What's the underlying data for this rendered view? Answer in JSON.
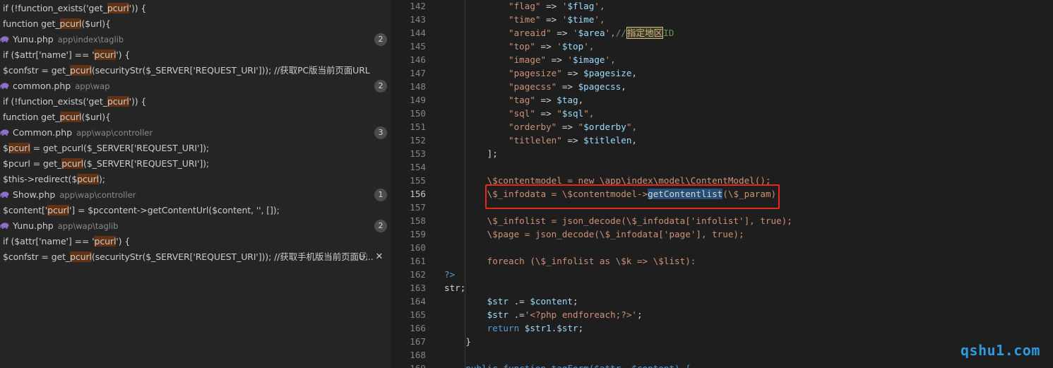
{
  "search_results": [
    {
      "kind": "match",
      "parts": [
        "if (!function_exists('get_",
        {
          "hl": "pcurl"
        },
        "')) {"
      ]
    },
    {
      "kind": "match",
      "parts": [
        "function get_",
        {
          "hl": "pcurl"
        },
        "($url){"
      ]
    },
    {
      "kind": "file",
      "name": "Yunu.php",
      "path": "app\\index\\taglib",
      "count": "2",
      "icon": "php-elephant-icon"
    },
    {
      "kind": "match",
      "parts": [
        "if ($attr['name'] == '",
        {
          "hl": "pcurl"
        },
        "') {"
      ]
    },
    {
      "kind": "match",
      "parts": [
        "$confstr = get_",
        {
          "hl": "pcurl"
        },
        "(securityStr($_SERVER['REQUEST_URI'])); //获取PC版当前页面URL"
      ]
    },
    {
      "kind": "file",
      "name": "common.php",
      "path": "app\\wap",
      "count": "2",
      "icon": "php-elephant-icon"
    },
    {
      "kind": "match",
      "parts": [
        "if (!function_exists('get_",
        {
          "hl": "pcurl"
        },
        "')) {"
      ]
    },
    {
      "kind": "match",
      "parts": [
        "function get_",
        {
          "hl": "pcurl"
        },
        "($url){"
      ]
    },
    {
      "kind": "file",
      "name": "Common.php",
      "path": "app\\wap\\controller",
      "count": "3",
      "icon": "php-elephant-icon"
    },
    {
      "kind": "match",
      "parts": [
        "$",
        {
          "hl": "pcurl"
        },
        " = get_pcurl($_SERVER['REQUEST_URI']);"
      ]
    },
    {
      "kind": "match",
      "parts": [
        "$pcurl = get_",
        {
          "hl": "pcurl"
        },
        "($_SERVER['REQUEST_URI']);"
      ]
    },
    {
      "kind": "match",
      "parts": [
        "$this->redirect($",
        {
          "hl": "pcurl"
        },
        ");"
      ]
    },
    {
      "kind": "file",
      "name": "Show.php",
      "path": "app\\wap\\controller",
      "count": "1",
      "icon": "php-elephant-icon"
    },
    {
      "kind": "match",
      "parts": [
        "$content['",
        {
          "hl": "pcurl"
        },
        "'] = $pccontent->getContentUrl($content, '', []);"
      ]
    },
    {
      "kind": "file",
      "name": "Yunu.php",
      "path": "app\\wap\\taglib",
      "count": "2",
      "icon": "php-elephant-icon"
    },
    {
      "kind": "match",
      "parts": [
        "if ($attr['name'] == '",
        {
          "hl": "pcurl"
        },
        "') {"
      ]
    },
    {
      "kind": "match",
      "actions": true,
      "parts": [
        "$confstr = get_",
        {
          "hl": "pcurl"
        },
        "(securityStr($_SERVER['REQUEST_URI'])); //获取手机版当前页面U..."
      ]
    }
  ],
  "row_actions": {
    "replace_icon": "replace-icon",
    "replace_glyph": "⎘",
    "dismiss_icon": "close-icon",
    "dismiss_glyph": "✕"
  },
  "editor": {
    "active_line": "156",
    "lines": [
      {
        "n": "142",
        "t": [
          [
            "            ",
            "op"
          ],
          [
            "\"flag\"",
            "str"
          ],
          [
            " => ",
            "op"
          ],
          [
            "'",
            "str"
          ],
          [
            "$flag",
            "var"
          ],
          [
            "',",
            "str"
          ]
        ]
      },
      {
        "n": "143",
        "t": [
          [
            "            ",
            "op"
          ],
          [
            "\"time\"",
            "str"
          ],
          [
            " => ",
            "op"
          ],
          [
            "'",
            "str"
          ],
          [
            "$time",
            "var"
          ],
          [
            "',",
            "str"
          ]
        ]
      },
      {
        "n": "144",
        "t": [
          [
            "            ",
            "op"
          ],
          [
            "\"areaid\"",
            "str"
          ],
          [
            " => ",
            "op"
          ],
          [
            "'",
            "str"
          ],
          [
            "$area",
            "var"
          ],
          [
            "',",
            "str"
          ],
          [
            "//",
            "cmt"
          ],
          [
            "指定地区",
            "cmtbox"
          ],
          [
            "ID",
            "cmt"
          ]
        ]
      },
      {
        "n": "145",
        "t": [
          [
            "            ",
            "op"
          ],
          [
            "\"top\"",
            "str"
          ],
          [
            " => ",
            "op"
          ],
          [
            "'",
            "str"
          ],
          [
            "$top",
            "var"
          ],
          [
            "',",
            "str"
          ]
        ]
      },
      {
        "n": "146",
        "t": [
          [
            "            ",
            "op"
          ],
          [
            "\"image\"",
            "str"
          ],
          [
            " => ",
            "op"
          ],
          [
            "'",
            "str"
          ],
          [
            "$image",
            "var"
          ],
          [
            "',",
            "str"
          ]
        ]
      },
      {
        "n": "147",
        "t": [
          [
            "            ",
            "op"
          ],
          [
            "\"pagesize\"",
            "str"
          ],
          [
            " => ",
            "op"
          ],
          [
            "$pagesize",
            "var"
          ],
          [
            ",",
            "op"
          ]
        ]
      },
      {
        "n": "148",
        "t": [
          [
            "            ",
            "op"
          ],
          [
            "\"pagecss\"",
            "str"
          ],
          [
            " => ",
            "op"
          ],
          [
            "$pagecss",
            "var"
          ],
          [
            ",",
            "op"
          ]
        ]
      },
      {
        "n": "149",
        "t": [
          [
            "            ",
            "op"
          ],
          [
            "\"tag\"",
            "str"
          ],
          [
            " => ",
            "op"
          ],
          [
            "$tag",
            "var"
          ],
          [
            ",",
            "op"
          ]
        ]
      },
      {
        "n": "150",
        "t": [
          [
            "            ",
            "op"
          ],
          [
            "\"sql\"",
            "str"
          ],
          [
            " => ",
            "op"
          ],
          [
            "\"",
            "str"
          ],
          [
            "$sql",
            "var"
          ],
          [
            "\",",
            "str"
          ]
        ]
      },
      {
        "n": "151",
        "t": [
          [
            "            ",
            "op"
          ],
          [
            "\"orderby\"",
            "str"
          ],
          [
            " => ",
            "op"
          ],
          [
            "\"",
            "str"
          ],
          [
            "$orderby",
            "var"
          ],
          [
            "\",",
            "str"
          ]
        ]
      },
      {
        "n": "152",
        "t": [
          [
            "            ",
            "op"
          ],
          [
            "\"titlelen\"",
            "str"
          ],
          [
            " => ",
            "op"
          ],
          [
            "$titlelen",
            "var"
          ],
          [
            ",",
            "op"
          ]
        ]
      },
      {
        "n": "153",
        "t": [
          [
            "        ];",
            "op"
          ]
        ]
      },
      {
        "n": "154",
        "t": []
      },
      {
        "n": "155",
        "t": [
          [
            "        \\$contentmodel = new \\app\\index\\model\\ContentModel();",
            "str"
          ]
        ]
      },
      {
        "n": "156",
        "t": [
          [
            "        \\$_infodata = \\$contentmodel->",
            "str"
          ],
          [
            "getContentlist",
            "sel"
          ],
          [
            "(\\$_param);",
            "str"
          ]
        ]
      },
      {
        "n": "157",
        "t": []
      },
      {
        "n": "158",
        "t": [
          [
            "        \\$_infolist = json_decode(\\$_infodata['infolist'], true);",
            "str"
          ]
        ]
      },
      {
        "n": "159",
        "t": [
          [
            "        \\$page = json_decode(\\$_infodata['page'], true);",
            "str"
          ]
        ]
      },
      {
        "n": "160",
        "t": []
      },
      {
        "n": "161",
        "t": [
          [
            "        foreach (\\$_infolist as \\$k => \\$list):",
            "str"
          ]
        ]
      },
      {
        "n": "162",
        "t": [
          [
            "?>",
            "kw"
          ]
        ]
      },
      {
        "n": "163",
        "t": [
          [
            "str;",
            "op"
          ]
        ]
      },
      {
        "n": "164",
        "t": [
          [
            "        ",
            "op"
          ],
          [
            "$str",
            "var"
          ],
          [
            " .= ",
            "op"
          ],
          [
            "$content",
            "var"
          ],
          [
            ";",
            "op"
          ]
        ]
      },
      {
        "n": "165",
        "t": [
          [
            "        ",
            "op"
          ],
          [
            "$str",
            "var"
          ],
          [
            " .=",
            "op"
          ],
          [
            "'<?php endforeach;?>'",
            "str"
          ],
          [
            ";",
            "op"
          ]
        ]
      },
      {
        "n": "166",
        "t": [
          [
            "        ",
            "op"
          ],
          [
            "return",
            "kw"
          ],
          [
            " ",
            "op"
          ],
          [
            "$str1",
            "var"
          ],
          [
            ".",
            "op"
          ],
          [
            "$str",
            "var"
          ],
          [
            ";",
            "op"
          ]
        ]
      },
      {
        "n": "167",
        "t": [
          [
            "    }",
            "op"
          ]
        ]
      },
      {
        "n": "168",
        "t": []
      },
      {
        "n": "169",
        "t": [
          [
            "    public function tagForm($attr, $content) {",
            "kw"
          ]
        ]
      }
    ]
  },
  "watermark": "qshu1.com"
}
